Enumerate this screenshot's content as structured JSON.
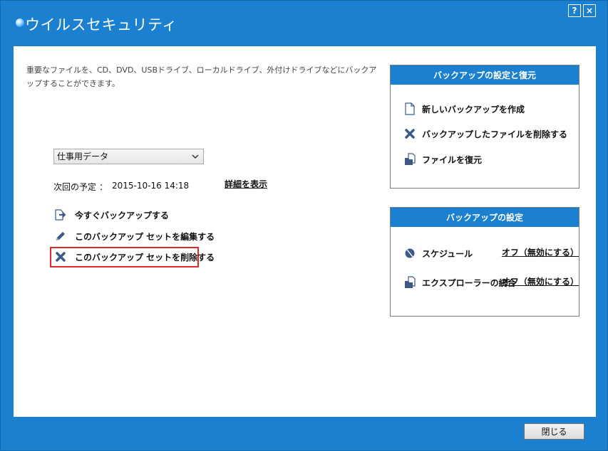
{
  "window": {
    "title": "ウイルスセキュリティ",
    "help_label": "?",
    "close_label": "×"
  },
  "main": {
    "description": "重要なファイルを、CD、DVD、USBドライブ、ローカルドライブ、外付けドライブなどにバックアップすることができます。",
    "backup_set": {
      "selected": "仕事用データ"
    },
    "schedule": {
      "label": "次回の予定",
      "separator": "：",
      "value": "2015-10-16 14:18"
    },
    "details_link": "詳細を表示",
    "actions": [
      {
        "label": "今すぐバックアップする",
        "icon": "backup-now-icon"
      },
      {
        "label": "このバックアップ セットを編集する",
        "icon": "pencil-icon"
      },
      {
        "label": "このバックアップ セットを削除する",
        "icon": "delete-x-icon"
      }
    ]
  },
  "panel_restore": {
    "title": "バックアップの設定と復元",
    "items": [
      {
        "label": "新しいバックアップを作成",
        "icon": "new-document-icon"
      },
      {
        "label": "バックアップしたファイルを削除する",
        "icon": "delete-x-icon"
      },
      {
        "label": "ファイルを復元",
        "icon": "folder-document-icon"
      }
    ]
  },
  "panel_settings": {
    "title": "バックアップの設定",
    "items": [
      {
        "label": "スケジュール",
        "status": "オフ（無効にする）",
        "icon": "schedule-icon"
      },
      {
        "label": "エクスプローラーの統合",
        "status": "オフ（無効にする）",
        "icon": "folder-document-icon"
      }
    ]
  },
  "footer": {
    "close_button": "閉じる"
  },
  "colors": {
    "accent": "#1b80d0",
    "highlight": "#e0282a",
    "icon": "#3d5a86"
  }
}
